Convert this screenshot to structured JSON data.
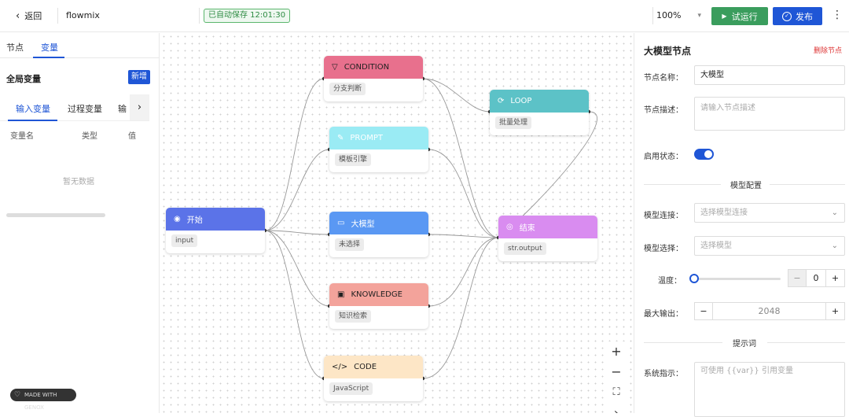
{
  "topbar": {
    "back_label": "返回",
    "app_title": "flowmix",
    "autosave": "已自动保存 12:01:30",
    "zoom": "100%",
    "run_label": "试运行",
    "publish_label": "发布",
    "more": "⋮"
  },
  "left": {
    "tabs": [
      "节点",
      "变量"
    ],
    "global_vars": "全局变量",
    "new_label": "新增",
    "subtabs": [
      "输入变量",
      "过程变量",
      "输"
    ],
    "columns": [
      "变量名",
      "类型",
      "值"
    ],
    "empty": "暂无数据",
    "made_with": "MADE WITH GENOX"
  },
  "nodes": {
    "start": {
      "title": "开始",
      "tag": "input",
      "color": "#5b73e8"
    },
    "condition": {
      "title": "CONDITION",
      "tag": "分支判断",
      "color": "#e8708d"
    },
    "prompt": {
      "title": "PROMPT",
      "tag": "模板引擎",
      "color": "#9aebf4"
    },
    "llm": {
      "title": "大模型",
      "tag": "未选择",
      "color": "#5a98f3"
    },
    "knowledge": {
      "title": "KNOWLEDGE",
      "tag": "知识检索",
      "color": "#f3a39b"
    },
    "code": {
      "title": "CODE",
      "tag": "JavaScript",
      "color": "#fde6c6"
    },
    "loop": {
      "title": "LOOP",
      "tag": "批量处理",
      "color": "#5cc2c7"
    },
    "end": {
      "title": "结束",
      "tag": "str.output",
      "color": "#d98cf0"
    }
  },
  "zoom_controls": [
    "+",
    "−",
    "⛶",
    "›"
  ],
  "right": {
    "title": "大模型节点",
    "delete": "删除节点",
    "name_label": "节点名称：",
    "name_value": "大模型",
    "desc_label": "节点描述：",
    "desc_placeholder": "请输入节点描述",
    "enable_label": "启用状态：",
    "enabled": true,
    "model_config": "模型配置",
    "conn_label": "模型连接：",
    "conn_placeholder": "选择模型连接",
    "model_label": "模型选择：",
    "model_placeholder": "选择模型",
    "temp_label": "温度：",
    "temp_value": "0",
    "maxout_label": "最大输出：",
    "maxout_value": "2048",
    "prompt_section": "提示词",
    "sys_label": "系统指示：",
    "sys_placeholder": "可使用 {{var}} 引用变量"
  },
  "colors": {
    "accent": "#1f56d6",
    "run": "#3a9d5d",
    "danger": "#dd3333"
  }
}
